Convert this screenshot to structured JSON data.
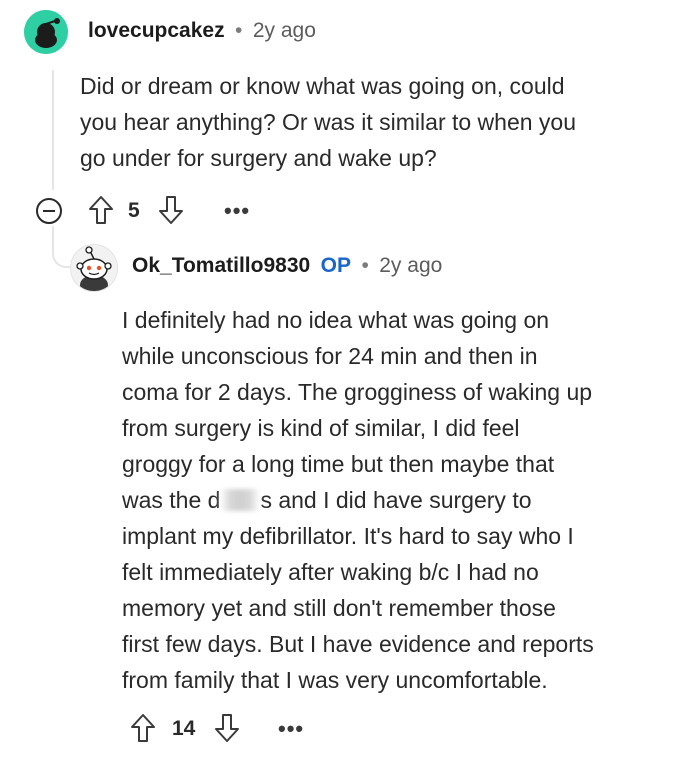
{
  "comment1": {
    "username": "lovecupcakez",
    "separator": "•",
    "time": "2y ago",
    "body_lines": [
      "Did or dream or know what was going on, could",
      "you hear anything? Or was it similar to when you",
      "go under for surgery and wake up?"
    ],
    "votes": "5",
    "more_label": "•••"
  },
  "comment2": {
    "username": "Ok_Tomatillo9830",
    "op_badge": "OP",
    "separator": "•",
    "time": "2y ago",
    "body_lines": [
      "I definitely had no idea what was going on",
      "while unconscious for 24 min and then in",
      "coma for 2 days. The grogginess of waking up",
      "from surgery is kind of similar, I did feel",
      "groggy for a long time but then maybe that",
      "implant my defibrillator. It's hard to say who I",
      "felt immediately after waking b/c I had no",
      "memory yet and still don't remember those",
      "first few days. But I have evidence and reports",
      "from family that I was very uncomfortable."
    ],
    "redacted_line_start": "was the d",
    "redacted_line_end": "s and I did have surgery to",
    "votes": "14",
    "more_label": "•••"
  },
  "colors": {
    "avatar_teal": "#2ecfa3",
    "op_blue": "#1a66c9",
    "thread_line": "#e5e5e5"
  },
  "icons": [
    "snoo-avatar-icon",
    "upvote-arrow-icon",
    "downvote-arrow-icon",
    "collapse-minus-icon",
    "more-options-icon"
  ]
}
